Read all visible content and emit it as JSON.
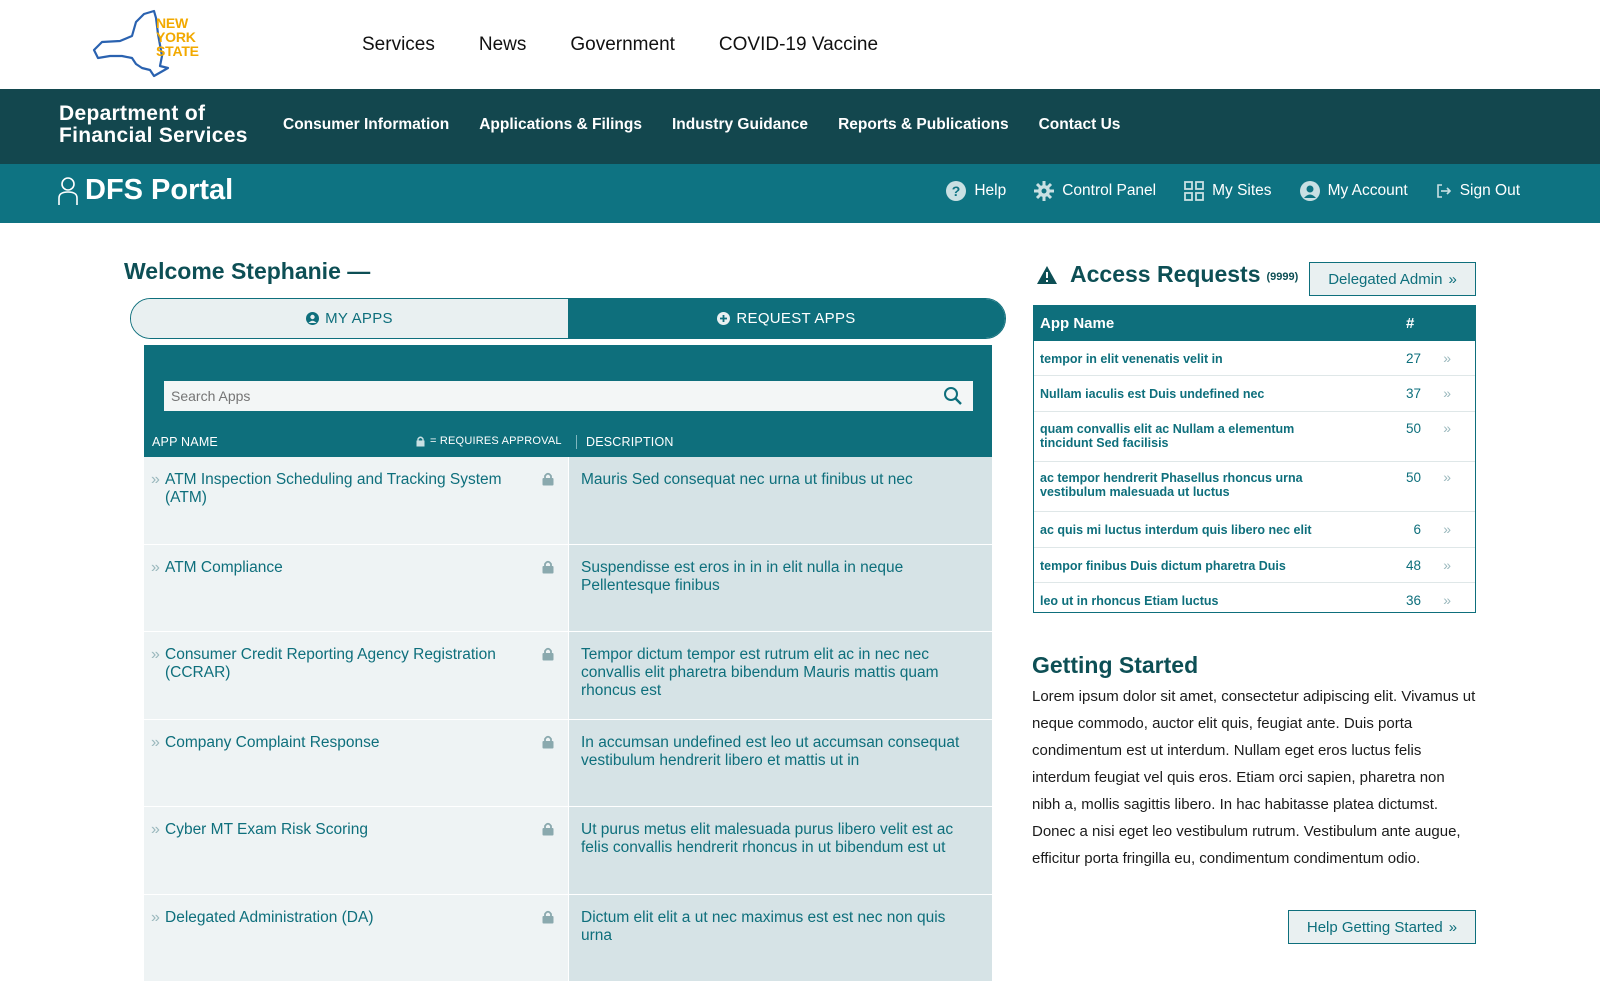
{
  "state_logo": {
    "text_line1": "NEW",
    "text_line2": "YORK",
    "text_line3": "STATE"
  },
  "state_nav": [
    "Services",
    "News",
    "Government",
    "COVID-19 Vaccine"
  ],
  "dfs": {
    "title_line1": "Department of",
    "title_line2": "Financial Services",
    "nav": [
      "Consumer Information",
      "Applications & Filings",
      "Industry Guidance",
      "Reports & Publications",
      "Contact Us"
    ]
  },
  "portal": {
    "title": "DFS Portal",
    "nav": [
      {
        "label": "Help",
        "icon": "help-icon"
      },
      {
        "label": "Control Panel",
        "icon": "gear-icon"
      },
      {
        "label": "My Sites",
        "icon": "grid-icon"
      },
      {
        "label": "My Account",
        "icon": "user-icon"
      },
      {
        "label": "Sign Out",
        "icon": "sign-out-icon"
      }
    ]
  },
  "welcome": "Welcome Stephanie —",
  "tabs": {
    "my_apps": "MY APPS",
    "request_apps": "REQUEST APPS"
  },
  "apps": {
    "search_placeholder": "Search Apps",
    "col_name": "APP NAME",
    "col_approval": "= REQUIRES APPROVAL",
    "col_description": "DESCRIPTION",
    "rows": [
      {
        "name": "ATM Inspection Scheduling and Tracking System (ATM)",
        "description": "Mauris Sed consequat nec urna ut finibus ut nec"
      },
      {
        "name": "ATM Compliance",
        "description": "Suspendisse est eros in in in elit nulla in neque Pellentesque finibus"
      },
      {
        "name": "Consumer Credit Reporting Agency Registration (CCRAR)",
        "description": "Tempor dictum tempor est rutrum elit ac in nec nec convallis elit pharetra bibendum Mauris mattis quam rhoncus est"
      },
      {
        "name": "Company Complaint Response",
        "description": "In accumsan undefined est leo ut accumsan consequat vestibulum hendrerit libero et mattis ut in"
      },
      {
        "name": "Cyber MT Exam Risk Scoring",
        "description": "Ut purus metus elit malesuada purus libero velit est ac felis convallis hendrerit rhoncus in ut bibendum est ut"
      },
      {
        "name": "Delegated Administration (DA)",
        "description": "Dictum elit elit a ut nec maximus est est nec non quis urna"
      }
    ]
  },
  "access_requests": {
    "title": "Access Requests",
    "count": "(9999)",
    "delegated_button": "Delegated Admin",
    "col_name": "App Name",
    "col_count": "#",
    "rows": [
      {
        "name": "tempor in elit venenatis velit in",
        "count": "27"
      },
      {
        "name": "Nullam iaculis est Duis undefined nec",
        "count": "37"
      },
      {
        "name": "quam convallis elit ac Nullam a elementum tincidunt Sed facilisis",
        "count": "50"
      },
      {
        "name": "ac tempor hendrerit Phasellus rhoncus urna vestibulum malesuada ut luctus",
        "count": "50"
      },
      {
        "name": "ac quis mi luctus interdum quis libero nec elit",
        "count": "6"
      },
      {
        "name": "tempor finibus Duis dictum pharetra Duis",
        "count": "48"
      },
      {
        "name": "leo ut in rhoncus Etiam luctus",
        "count": "36"
      }
    ]
  },
  "getting_started": {
    "title": "Getting Started",
    "body": "Lorem ipsum dolor sit amet, consectetur adipiscing elit. Vivamus ut neque commodo, auctor elit quis, feugiat ante. Duis porta condimentum est ut interdum. Nullam eget eros luctus felis interdum feugiat vel quis eros. Etiam orci sapien, pharetra non nibh a, mollis sagittis libero. In hac habitasse platea dictumst. Donec a nisi eget leo vestibulum rutrum. Vestibulum ante augue, efficitur porta fringilla eu, condimentum condimentum odio.",
    "button": "Help Getting Started"
  },
  "colors": {
    "dark_teal": "#13474e",
    "teal": "#0e7382",
    "accent_gold": "#f2a900"
  }
}
